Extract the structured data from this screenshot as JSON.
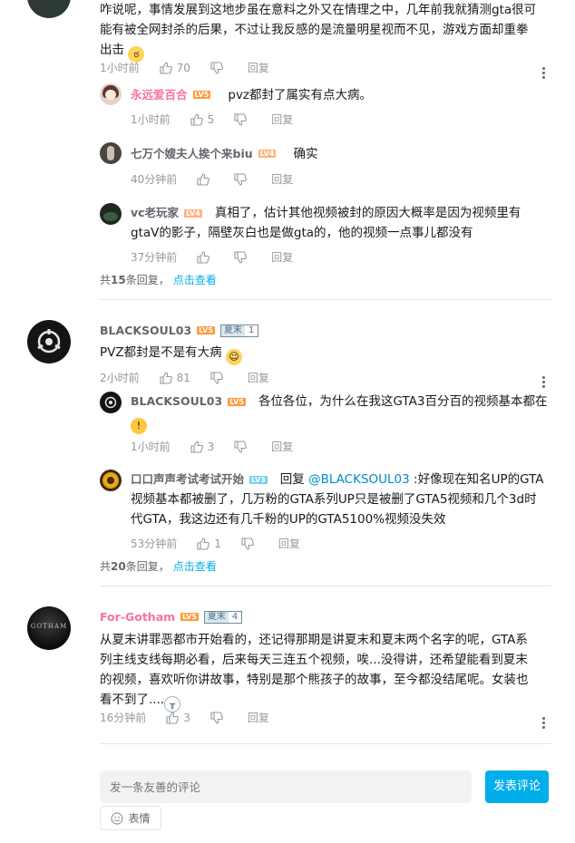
{
  "top": {
    "text_line1": "咋说呢，事情发展到这地步虽在意料之外又在情理之中，几年前我就猜测gta很可",
    "text_line2": "能有被全网封杀的后果，不过让我反感的是流量明星视而不见，游戏方面却重拳",
    "text_line3": "出击",
    "time": "1小时前",
    "likes": "70",
    "reply": "回复",
    "replies": [
      {
        "name": "永远爱百合",
        "level": "LV5",
        "text": "pvz都封了属实有点大病。",
        "time": "1小时前",
        "likes": "5",
        "reply": "回复"
      },
      {
        "name": "七万个嫂夫人挨个来biu",
        "level": "LV4",
        "text": "确实",
        "time": "40分钟前",
        "likes": "",
        "reply": "回复"
      },
      {
        "name": "vc老玩家",
        "level": "LV4",
        "text_line1": "真相了，估计其他视频被封的原因大概率是因为视频里有",
        "text_line2": "gtaV的影子，隔壁灰白也是做gta的，他的视频一点事儿都没有",
        "time": "37分钟前",
        "likes": "",
        "reply": "回复"
      }
    ],
    "summary_pre": "共",
    "summary_count": "15",
    "summary_post": "条回复，",
    "summary_link": "点击查看"
  },
  "second": {
    "name": "BLACKSOUL03",
    "level": "LV5",
    "fan_label": "夏末",
    "fan_level": "1",
    "text": "PVZ都封是不是有大病",
    "time": "2小时前",
    "likes": "81",
    "reply": "回复",
    "replies": [
      {
        "name": "BLACKSOUL03",
        "level": "LV5",
        "text_line1": "各位各位，为什么在我这GTA3百分百的视频基本都在",
        "time": "1小时前",
        "likes": "3",
        "reply": "回复"
      },
      {
        "name": "口口声声考试考试开始",
        "level": "LV3",
        "reply_prefix": "回复",
        "at": "@BLACKSOUL03",
        "text_line1": ":好像现在知名UP的GTA",
        "text_line2": "视频基本都被删了，几万粉的GTA系列UP只是被删了GTA5视频和几个3d时",
        "text_line3": "代GTA，我这边还有几千粉的UP的GTA5100%视频没失效",
        "time": "53分钟前",
        "likes": "1",
        "reply": "回复"
      }
    ],
    "summary_pre": "共",
    "summary_count": "20",
    "summary_post": "条回复，",
    "summary_link": "点击查看"
  },
  "third": {
    "name": "For-Gotham",
    "level": "LV5",
    "fan_label": "夏末",
    "fan_level": "4",
    "avatar_text": "GOTHAM",
    "text_line1": "从夏末讲罪恶都市开始看的，还记得那期是讲夏末和夏末两个名字的呢，GTA系",
    "text_line2": "列主线支线每期必看，后来每天三连五个视频，唉...没得讲，还希望能看到夏末",
    "text_line3": "的视频，喜欢听你讲故事，特别是那个熊孩子的故事，至今都没结尾呢。女装也",
    "text_line4": "看不到了....",
    "time": "16分钟前",
    "likes": "3",
    "reply": "回复"
  },
  "composer": {
    "placeholder": "发一条友善的评论",
    "submit": "发表评论",
    "emoji": "表情"
  },
  "colors": {
    "accent": "#00aeec",
    "vip_pink": "#fb7299",
    "level5": "#ff9a3c"
  }
}
